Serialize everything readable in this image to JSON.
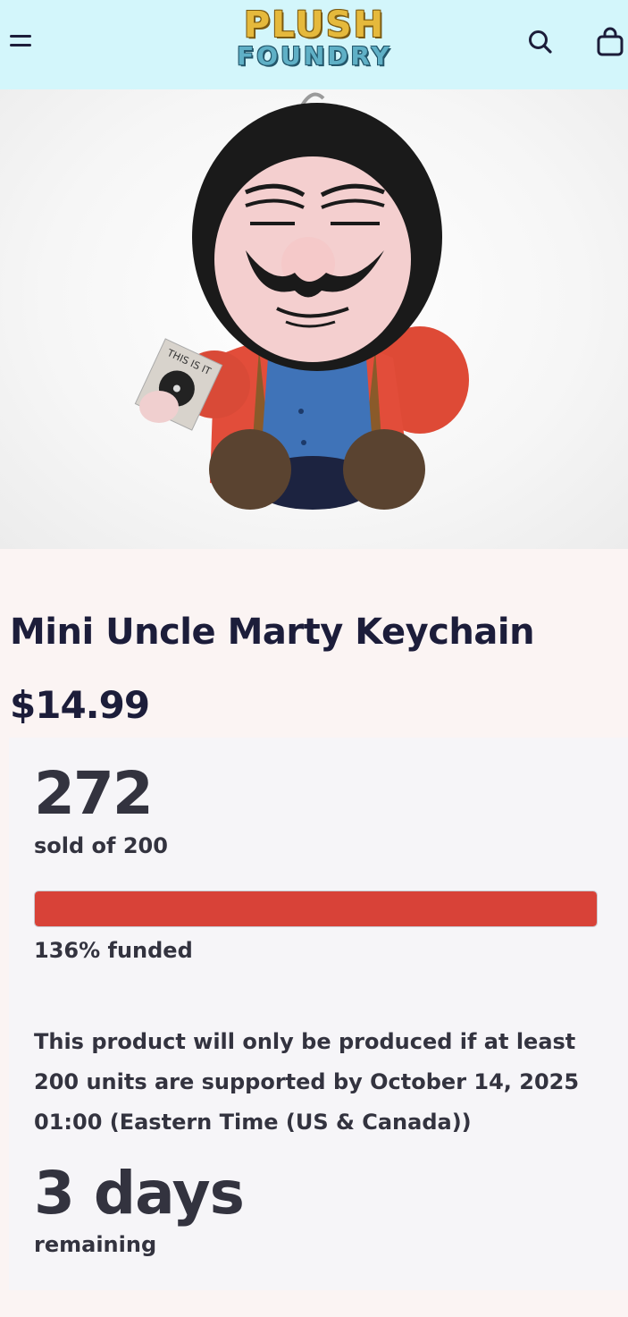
{
  "header": {
    "logo_top": "PLUSH",
    "logo_bottom": "FOUNDRY",
    "icons": [
      "menu-icon",
      "search-icon",
      "shopping-bag-icon"
    ]
  },
  "gallery": {
    "image_name": "mini-uncle-marty-plush",
    "card_text": "THIS IS IT",
    "active_index": 0,
    "dot_count": 5
  },
  "product": {
    "title": "Mini Uncle Marty Keychain",
    "price": "$14.99"
  },
  "campaign": {
    "sold_count": "272",
    "sold_of_label": "sold of 200",
    "funded_percent": 136,
    "funded_label": "136% funded",
    "notice": "This product will only be produced if at least 200 units are supported by October 14, 2025 01:00 (Eastern Time (US & Canada))",
    "days_value": "3 days",
    "remaining_label": "remaining"
  },
  "colors": {
    "header_bg": "#d3f6fb",
    "title_text": "#1c1d3a",
    "progress_fill": "#d84238",
    "panel_bg": "#f6f5f8"
  }
}
